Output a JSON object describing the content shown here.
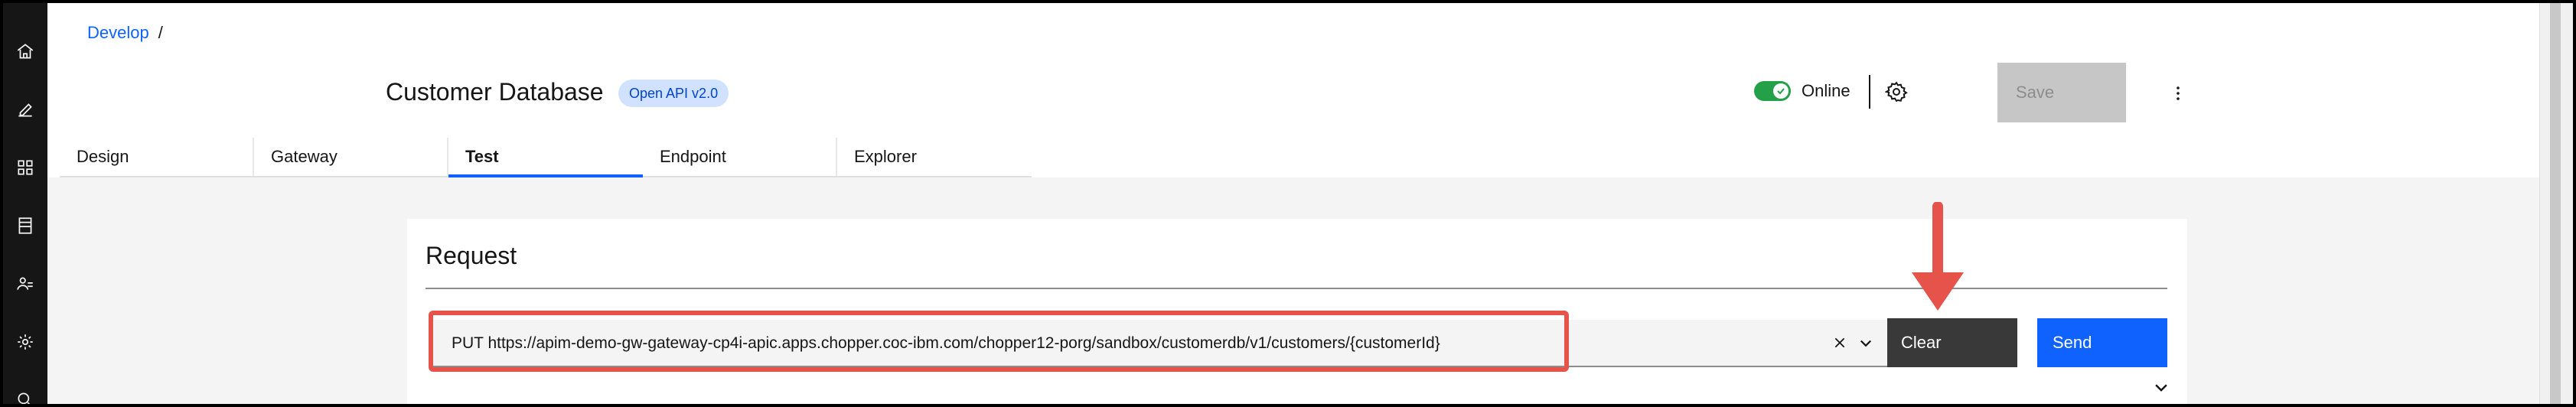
{
  "breadcrumb": {
    "link": "Develop",
    "separator": "/"
  },
  "api": {
    "title": "Customer Database",
    "badge": "Open API v2.0"
  },
  "status": {
    "label": "Online"
  },
  "toolbar": {
    "save_label": "Save"
  },
  "tabs": [
    {
      "label": "Design",
      "active": false
    },
    {
      "label": "Gateway",
      "active": false
    },
    {
      "label": "Test",
      "active": true
    },
    {
      "label": "Endpoint",
      "active": false
    },
    {
      "label": "Explorer",
      "active": false
    }
  ],
  "request": {
    "title": "Request",
    "url": "PUT https://apim-demo-gw-gateway-cp4i-apic.apps.chopper.coc-ibm.com/chopper12-porg/sandbox/customerdb/v1/customers/{customerId}",
    "clear_label": "Clear",
    "send_label": "Send"
  },
  "rail": {
    "icons": [
      "home-icon",
      "edit-icon",
      "apps-icon",
      "catalog-icon",
      "users-icon",
      "settings-icon",
      "search-icon"
    ]
  },
  "colors": {
    "primary": "#0f62fe",
    "toggle_on": "#24a148",
    "highlight": "#e5534b",
    "rail_bg": "#161616"
  }
}
